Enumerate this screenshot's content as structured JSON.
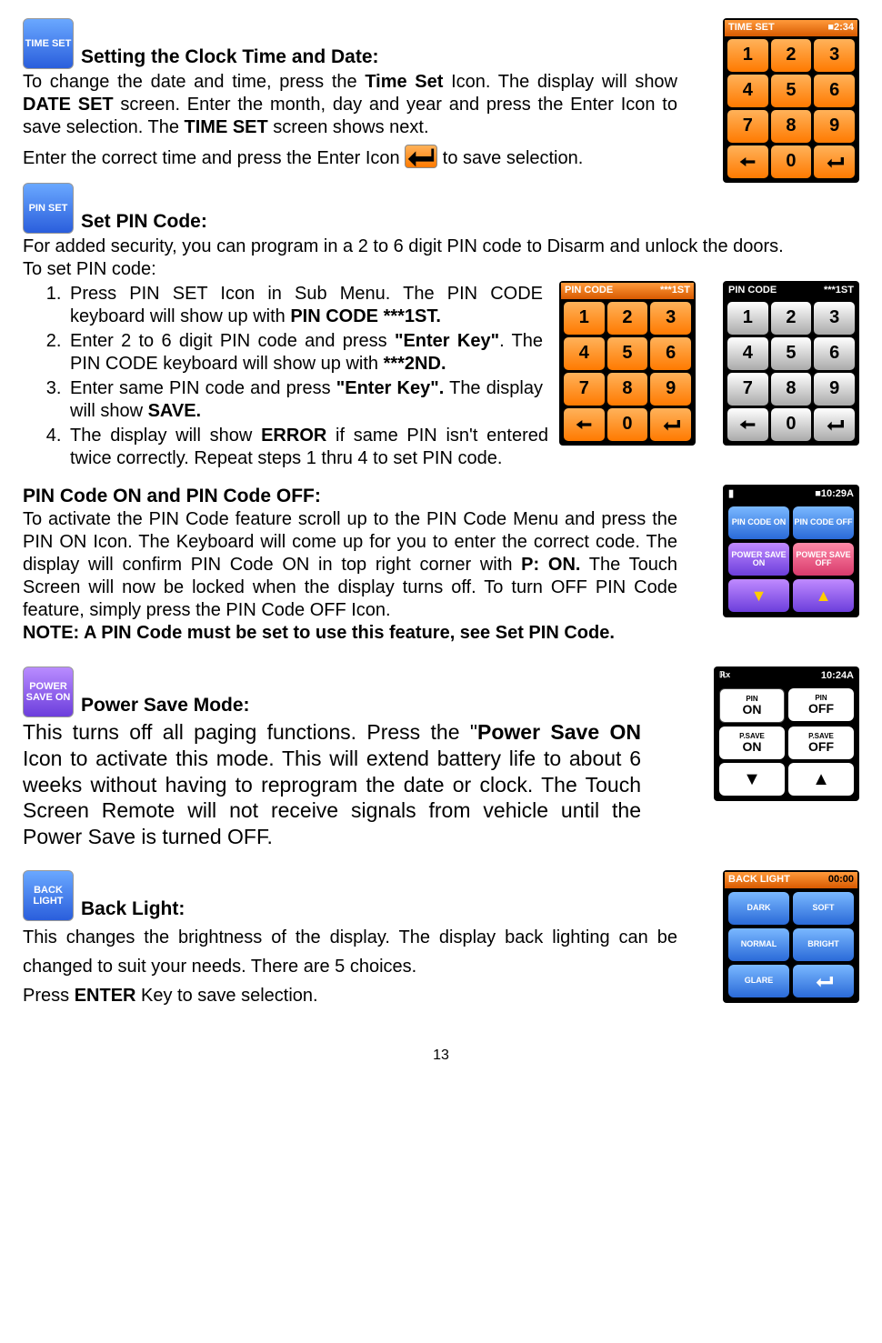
{
  "page_number": "13",
  "timeset": {
    "icon_label": "TIME SET",
    "heading": "Setting the Clock Time and Date:",
    "body_pre": "To change the date and time, press the ",
    "body_time_set": "Time Set",
    "body_mid1": " Icon. The display will show ",
    "body_date_set": "DATE SET",
    "body_mid2": " screen. Enter the month, day and year and press the Enter Icon to save selection. The ",
    "body_time_set2": "TIME SET",
    "body_mid3": " screen shows next.",
    "body_line2_pre": "Enter the correct time and press the Enter Icon ",
    "body_line2_post": " to save selection.",
    "screen": {
      "title": "TIME SET",
      "status": "■2:34",
      "keys": [
        "1",
        "2",
        "3",
        "4",
        "5",
        "6",
        "7",
        "8",
        "9",
        "←",
        "0",
        "↵"
      ]
    }
  },
  "pinset": {
    "icon_label": "PIN SET",
    "heading": "Set PIN Code:",
    "body_line1": "For added security, you can program in a 2 to 6 digit PIN code to Disarm and unlock the doors.",
    "body_line2": "To set PIN code:",
    "steps": {
      "s1_a": "Press PIN SET Icon in Sub Menu. The PIN CODE keyboard will show up with ",
      "s1_b": "PIN CODE ***1ST.",
      "s2_a": "Enter 2 to 6 digit PIN code and press ",
      "s2_b": "\"Enter Key\"",
      "s2_c": ". The PIN CODE keyboard will show up with ",
      "s2_d": "***2ND.",
      "s3_a": "Enter same PIN code and press ",
      "s3_b": "\"Enter Key\".",
      "s3_c": " The display will show ",
      "s3_d": "SAVE.",
      "s4_a": "The display will show ",
      "s4_b": "ERROR",
      "s4_c": " if same PIN isn't entered twice correctly. Repeat steps 1 thru 4 to set PIN code."
    },
    "screen": {
      "title": "PIN CODE",
      "status": "***1ST",
      "keys": [
        "1",
        "2",
        "3",
        "4",
        "5",
        "6",
        "7",
        "8",
        "9",
        "←",
        "0",
        "↵"
      ]
    }
  },
  "pinonoff": {
    "heading": "PIN Code ON and PIN Code OFF:",
    "body_a": "To activate the PIN Code feature scroll up to the PIN Code Menu and press the PIN ON Icon. The Keyboard will come up for you to enter the correct code. The display will confirm PIN Code ON in top right corner with ",
    "body_b": "P: ON.",
    "body_c": " The Touch Screen will now be locked when the display turns off. To turn OFF PIN Code feature, simply press the PIN Code OFF Icon.",
    "note": "NOTE: A PIN Code must be set to use this feature, see Set PIN Code.",
    "screen": {
      "status": "■10:29A",
      "buttons": [
        "PIN CODE ON",
        "PIN CODE OFF",
        "POWER SAVE ON",
        "POWER SAVE OFF",
        "↓",
        "↑"
      ]
    }
  },
  "powersave": {
    "icon_label": "POWER SAVE ON",
    "heading": "Power Save Mode:",
    "body_a": "This turns off all paging functions. Press the \"",
    "body_b": "Power Save ON",
    "body_c": " Icon to activate this mode. This will extend battery life to about 6 weeks without having to reprogram the date or clock. The Touch Screen Remote will not receive signals from vehicle until the Power Save is turned OFF.",
    "screen": {
      "status": "10:24A",
      "rows": [
        {
          "l": {
            "sub": "PIN",
            "main": "ON"
          },
          "r": {
            "sub": "PIN",
            "main": "OFF"
          }
        },
        {
          "l": {
            "sub": "P.SAVE",
            "main": "ON"
          },
          "r": {
            "sub": "P.SAVE",
            "main": "OFF"
          }
        }
      ]
    }
  },
  "backlight": {
    "icon_label": "BACK LIGHT",
    "heading": "Back Light:",
    "body_line1": "This changes the brightness of the display. The display back lighting can be changed to suit your needs. There are 5 choices.",
    "body_line2_a": "Press ",
    "body_line2_b": "ENTER",
    "body_line2_c": " Key to save selection.",
    "screen": {
      "title": "BACK LIGHT",
      "status": "00:00",
      "buttons": [
        "DARK",
        "SOFT",
        "NORMAL",
        "BRIGHT",
        "GLARE",
        "↵"
      ]
    }
  }
}
